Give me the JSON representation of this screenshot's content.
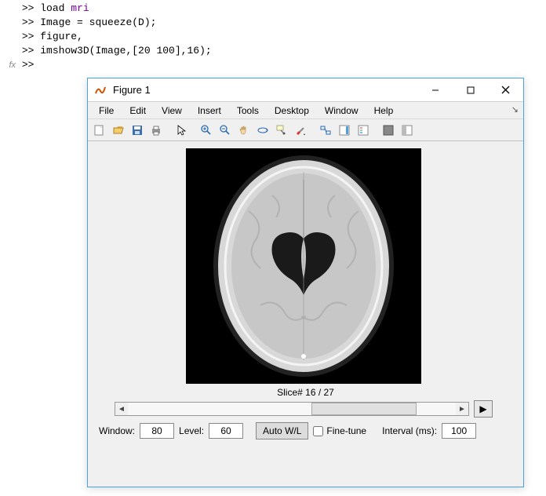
{
  "command_window": {
    "lines": [
      {
        "prompt": ">>",
        "text": "load ",
        "kw": "mri"
      },
      {
        "prompt": ">>",
        "text": "Image = squeeze(D);"
      },
      {
        "prompt": ">>",
        "text": "figure,"
      },
      {
        "prompt": ">>",
        "text": "imshow3D(Image,[20 100],16);"
      },
      {
        "prompt": ">>",
        "text": "",
        "fx": true
      }
    ],
    "fx_label": "fx"
  },
  "figure": {
    "title": "Figure 1",
    "menus": [
      "File",
      "Edit",
      "View",
      "Insert",
      "Tools",
      "Desktop",
      "Window",
      "Help"
    ],
    "docker_glyph": "↘",
    "toolbar": [
      "new-figure-icon",
      "open-icon",
      "save-icon",
      "print-icon",
      "--",
      "pointer-icon",
      "--",
      "zoom-in-icon",
      "zoom-out-icon",
      "pan-icon",
      "rotate3d-icon",
      "datacursor-icon",
      "brush-icon",
      "--",
      "link-icon",
      "colorbar-icon",
      "legend-icon",
      "--",
      "hideplot-icon",
      "showplot-icon"
    ],
    "slice_label": "Slice# 16 / 27",
    "scroll": {
      "min": 1,
      "max": 27,
      "value": 16
    },
    "play_glyph": "▶",
    "controls": {
      "window_label": "Window:",
      "window_value": "80",
      "level_label": "Level:",
      "level_value": "60",
      "auto_label": "Auto W/L",
      "finetune_label": "Fine-tune",
      "finetune_checked": false,
      "interval_label": "Interval (ms):",
      "interval_value": "100"
    }
  }
}
